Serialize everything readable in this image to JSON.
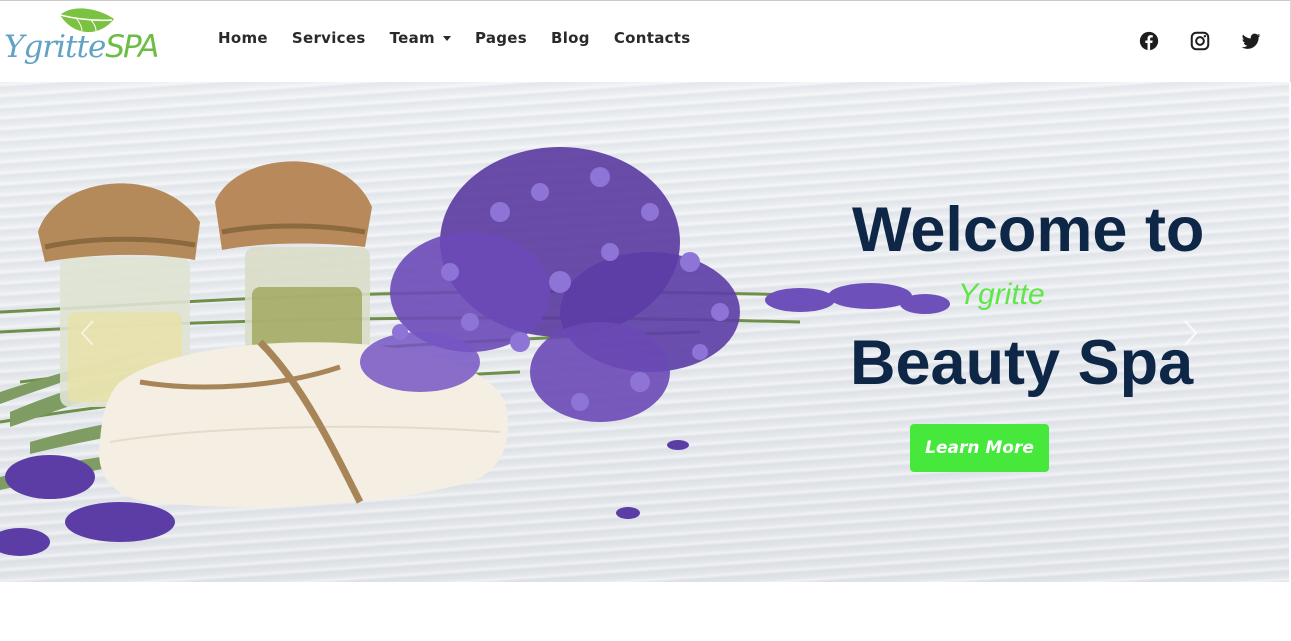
{
  "brand": {
    "logo_part1": "Ygritte",
    "logo_part2": "SPA"
  },
  "nav": {
    "items": [
      {
        "label": "Home"
      },
      {
        "label": "Services"
      },
      {
        "label": "Team",
        "has_dropdown": true
      },
      {
        "label": "Pages"
      },
      {
        "label": "Blog"
      },
      {
        "label": "Contacts"
      }
    ]
  },
  "social": [
    {
      "icon": "facebook-icon"
    },
    {
      "icon": "instagram-icon"
    },
    {
      "icon": "twitter-icon"
    }
  ],
  "hero": {
    "title_line1": "Welcome to",
    "brand_line": "Ygritte",
    "title_line2": "Beauty Spa",
    "cta_label": "Learn More",
    "colors": {
      "title": "#0f2747",
      "brand": "#5fe649",
      "cta": "#46e83b"
    }
  }
}
